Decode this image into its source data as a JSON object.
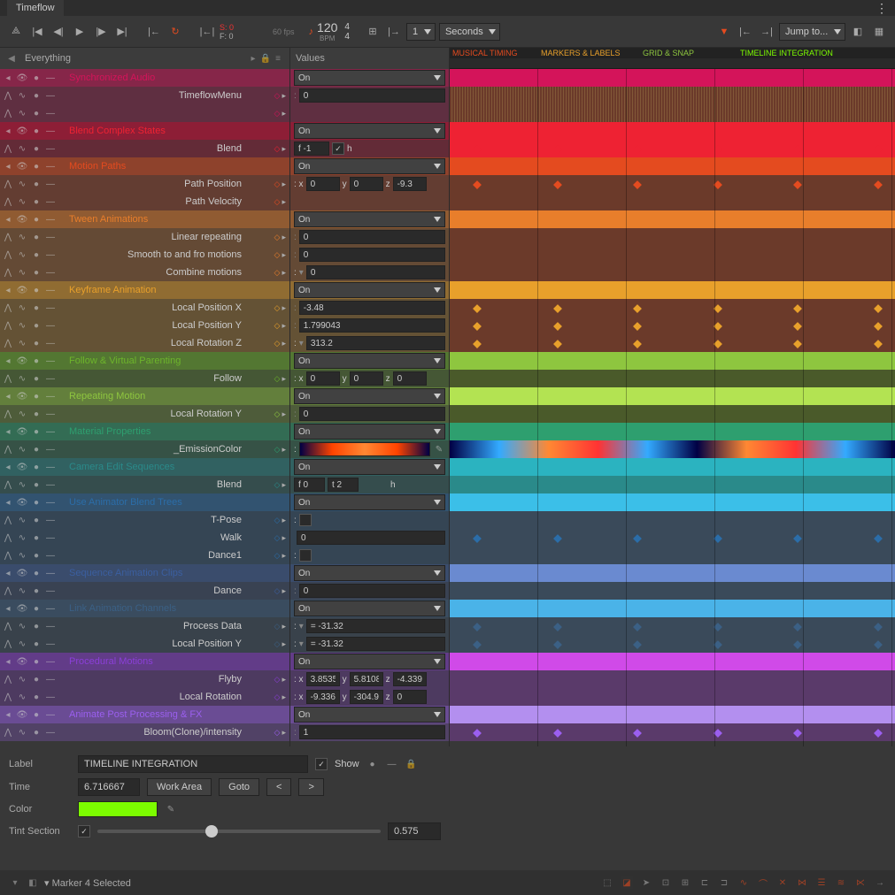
{
  "app_title": "Timeflow",
  "toolbar": {
    "s": "S: 0",
    "f": "F: 0",
    "fps": "60 fps",
    "bpm_num": "120",
    "bpm_label": "BPM",
    "sig_top": "4",
    "sig_bot": "4",
    "time_val": "1",
    "time_unit": "Seconds",
    "jump": "Jump to..."
  },
  "panel_headers": {
    "left": "Everything",
    "mid": "Values"
  },
  "markers": {
    "m1": "MUSICAL TIMING",
    "m2": "MARKERS & LABELS",
    "m3": "GRID & SNAP",
    "m4": "TIMELINE INTEGRATION"
  },
  "tracks": [
    {
      "label": "Synchronized Audio",
      "color": "#d4145a",
      "header": true,
      "val_type": "sel",
      "val": "On"
    },
    {
      "label": "TimeflowMenu",
      "color": "#d4145a",
      "val_type": "num",
      "val": ": 0"
    },
    {
      "label": "",
      "color": "#d4145a",
      "val_type": "empty"
    },
    {
      "label": "Blend Complex States",
      "color": "#e23",
      "header": true,
      "val_type": "sel",
      "val": "On"
    },
    {
      "label": "Blend",
      "color": "#e23",
      "val_type": "blend",
      "val_f": "f -1",
      "val_h": "h"
    },
    {
      "label": "Motion Paths",
      "color": "#e44b1f",
      "header": true,
      "val_type": "sel",
      "val": "On"
    },
    {
      "label": "Path Position",
      "color": "#e44b1f",
      "val_type": "xyz",
      "x": "0",
      "y": "0",
      "z": "-9.3"
    },
    {
      "label": "Path Velocity",
      "color": "#e44b1f",
      "val_type": "empty"
    },
    {
      "label": "Tween Animations",
      "color": "#e87e2b",
      "header": true,
      "val_type": "sel",
      "val": "On"
    },
    {
      "label": "Linear repeating",
      "color": "#e87e2b",
      "val_type": "num",
      "val": ": 0"
    },
    {
      "label": "Smooth to and fro motions",
      "color": "#e87e2b",
      "val_type": "num",
      "val": ": 0"
    },
    {
      "label": "Combine motions",
      "color": "#e87e2b",
      "val_type": "arrow_num",
      "val": "0"
    },
    {
      "label": "Keyframe Animation",
      "color": "#e8a02b",
      "header": true,
      "val_type": "sel",
      "val": "On"
    },
    {
      "label": "Local Position X",
      "color": "#e8a02b",
      "val_type": "num",
      "val": ":   -3.48"
    },
    {
      "label": "Local Position Y",
      "color": "#e8a02b",
      "val_type": "num",
      "val": ":   1.799043"
    },
    {
      "label": "Local Rotation Z",
      "color": "#e8a02b",
      "val_type": "arrow_num",
      "val": "313.2"
    },
    {
      "label": "Follow & Virtual Parenting",
      "color": "#6db52b",
      "header": true,
      "val_type": "sel",
      "val": "On"
    },
    {
      "label": "Follow",
      "color": "#6db52b",
      "val_type": "xyz",
      "x": "0",
      "y": "0",
      "z": "0"
    },
    {
      "label": "Repeating Motion",
      "color": "#8ec63f",
      "header": true,
      "val_type": "sel",
      "val": "On"
    },
    {
      "label": "Local Rotation Y",
      "color": "#8ec63f",
      "val_type": "num",
      "val": ": 0"
    },
    {
      "label": "Material Properties",
      "color": "#2e9f6f",
      "header": true,
      "val_type": "sel",
      "val": "On"
    },
    {
      "label": "_EmissionColor",
      "color": "#2e9f6f",
      "val_type": "grad"
    },
    {
      "label": "Camera Edit Sequences",
      "color": "#2a8a8a",
      "header": true,
      "val_type": "sel",
      "val": "On"
    },
    {
      "label": "Blend",
      "color": "#2a8a8a",
      "val_type": "blend2",
      "val_f": "f 0",
      "val_t": "t 2",
      "val_h": "h"
    },
    {
      "label": "Use Animator Blend Trees",
      "color": "#2b6da8",
      "header": true,
      "val_type": "sel",
      "val": "On"
    },
    {
      "label": "T-Pose",
      "color": "#2b6da8",
      "val_type": "check"
    },
    {
      "label": "Walk",
      "color": "#2b6da8",
      "val_type": "num",
      "val": "0"
    },
    {
      "label": "Dance1",
      "color": "#2b6da8",
      "val_type": "check"
    },
    {
      "label": "Sequence Animation Clips",
      "color": "#3b5fa0",
      "header": true,
      "val_type": "sel",
      "val": "On"
    },
    {
      "label": "Dance",
      "color": "#3b5fa0",
      "val_type": "num",
      "val": ": 0"
    },
    {
      "label": "Link Animation Channels",
      "color": "#3b6085",
      "header": true,
      "val_type": "sel",
      "val": "On"
    },
    {
      "label": "Process Data",
      "color": "#3b6085",
      "val_type": "arrow_num",
      "val": "= -31.32"
    },
    {
      "label": "Local Position Y",
      "color": "#3b6085",
      "val_type": "arrow_num",
      "val": "= -31.32"
    },
    {
      "label": "Procedural Motions",
      "color": "#8b3fd8",
      "header": true,
      "val_type": "sel",
      "val": "On"
    },
    {
      "label": "Flyby",
      "color": "#8b3fd8",
      "val_type": "xyz",
      "x": "3.8535",
      "y": "5.8108",
      "z": "-4.339"
    },
    {
      "label": "Local Rotation",
      "color": "#8b3fd8",
      "val_type": "xyz",
      "x": "-9.336",
      "y": "-304.9",
      "z": "0"
    },
    {
      "label": "Animate Post Processing & FX",
      "color": "#9b5fef",
      "header": true,
      "val_type": "sel",
      "val": "On"
    },
    {
      "label": "Bloom(Clone)/intensity",
      "color": "#9b5fef",
      "val_type": "num",
      "val": ": 1"
    }
  ],
  "timeline_colors": [
    "#d4145a",
    "#6b3a2a",
    "#6b3a2a",
    "#e23",
    "#e23",
    "#e44b1f",
    "#6b3a2a",
    "#6b3a2a",
    "#e87e2b",
    "#6b3a2a",
    "#6b3a2a",
    "#6b3a2a",
    "#e8a02b",
    "#6b3a2a",
    "#6b3a2a",
    "#6b3a2a",
    "#8ec63f",
    "#4a5a2a",
    "#b3e352",
    "#4a5a2a",
    "#2e9f6f",
    "",
    "#2bb3c0",
    "#2a8a8a",
    "#3bbfe8",
    "#3a4a5a",
    "#3a4a5a",
    "#3a4a5a",
    "#6a8ad0",
    "#3a4a5a",
    "#4ab3e8",
    "#3a4a5a",
    "#3a4a5a",
    "#d04ae8",
    "#5a3a6a",
    "#5a3a6a",
    "#b38fef",
    "#5a3a6a"
  ],
  "bottom": {
    "label_label": "Label",
    "label_val": "TIMELINE INTEGRATION",
    "show": "Show",
    "time_label": "Time",
    "time_val": "6.716667",
    "work_area": "Work Area",
    "goto": "Goto",
    "color_label": "Color",
    "tint_label": "Tint Section",
    "tint_val": "0.575"
  },
  "status": {
    "text": "▾ Marker 4 Selected"
  }
}
